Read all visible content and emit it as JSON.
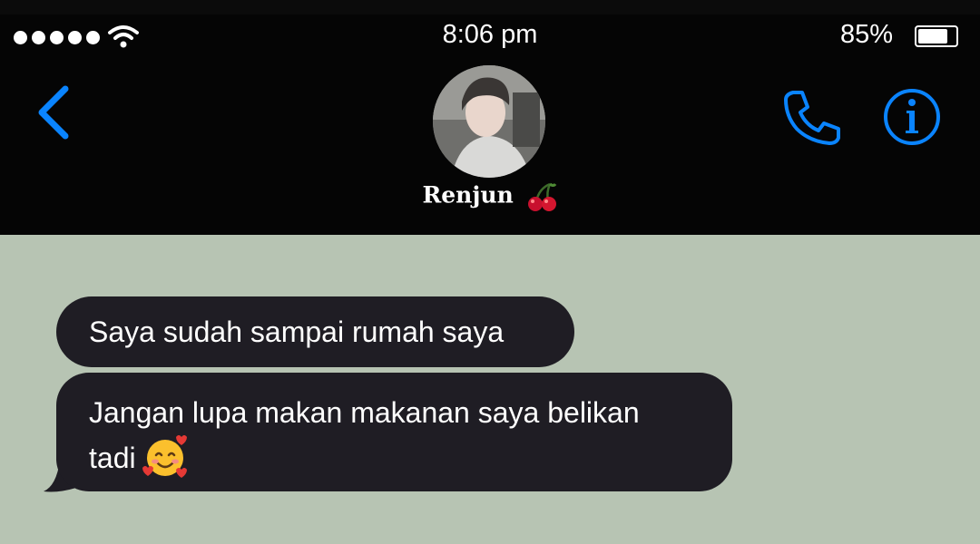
{
  "status_bar": {
    "time": "8:06 pm",
    "battery": "85%",
    "battery_level": 0.85
  },
  "header": {
    "contact_name": "Renjun",
    "name_emoji": "cherry-icon"
  },
  "messages": [
    {
      "text": "Saya sudah sampai rumah saya"
    },
    {
      "text_line1": "Jangan lupa makan makanan saya belikan",
      "text_line2": "tadi",
      "emoji": "smiling-face-with-hearts-icon"
    }
  ],
  "colors": {
    "accent": "#0a84ff",
    "bubble": "#1f1d24",
    "chat_bg": "#b7c4b3",
    "header_bg": "#050505"
  }
}
